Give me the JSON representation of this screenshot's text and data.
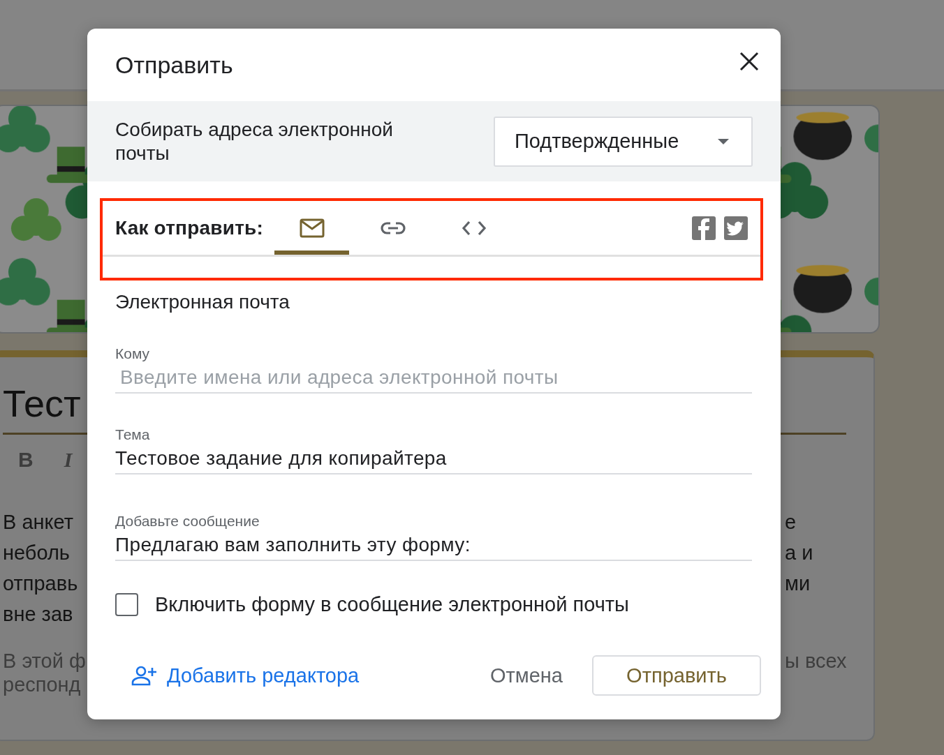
{
  "background": {
    "header_image": {
      "kind": "picture"
    },
    "form_title": "Тест",
    "toolbar": [
      "B",
      "I"
    ],
    "description": [
      {
        "left": "В анкет",
        "right": "е"
      },
      {
        "left": "неболь",
        "right": "а и"
      },
      {
        "left": "отправь",
        "right": "ми"
      },
      {
        "left": "вне зав"
      }
    ],
    "note": [
      {
        "left": "В этой ф",
        "right": "ы всех"
      },
      {
        "left": "респонд"
      }
    ]
  },
  "dialog": {
    "title": "Отправить",
    "collect_emails": {
      "label": "Собирать адреса электронной почты",
      "value": "Подтвержденные"
    },
    "send_via": {
      "label": "Как отправить:",
      "tabs": [
        {
          "kind": "email",
          "selected": true
        },
        {
          "kind": "link",
          "selected": false
        },
        {
          "kind": "embed",
          "selected": false
        }
      ],
      "share": [
        {
          "kind": "facebook"
        },
        {
          "kind": "twitter"
        }
      ]
    },
    "section_title": "Электронная почта",
    "fields": [
      {
        "label": "Кому",
        "placeholder": "Введите имена или адреса электронной почты"
      },
      {
        "label": "Тема",
        "value": "Тестовое задание для копирайтера"
      },
      {
        "label": "Добавьте сообщение",
        "value": "Предлагаю вам заполнить эту форму:"
      }
    ],
    "include_form": {
      "label": "Включить форму в сообщение электронной почты",
      "checked": false
    },
    "add_editor": "Добавить редактора",
    "buttons": [
      {
        "kind": "text",
        "label": "Отмена"
      },
      {
        "kind": "outlined",
        "label": "Отправить"
      }
    ]
  }
}
